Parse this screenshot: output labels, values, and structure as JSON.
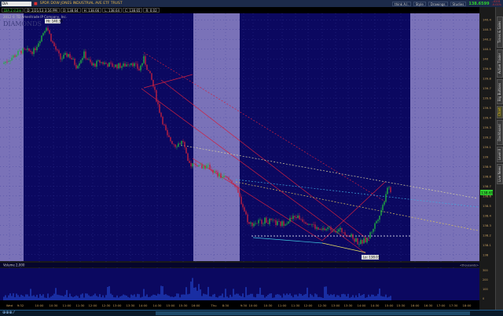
{
  "toolbar": {
    "symbol": "DIA",
    "description": "SPDR DOW JONES INDUSTRIAL AVE ETF TRUST",
    "buttons": [
      "think A.I.",
      "Style",
      "Drawings",
      "Studies"
    ],
    "last": "138.6599",
    "change": "-.0201",
    "change_pct": "-0.01%"
  },
  "infobar": {
    "aggregation": "DIA 2 d 2m",
    "date": "D: 2/21/13 3:16 PM",
    "open": "O: 138.64",
    "high": "H: 138.66",
    "low": "L: 138.64",
    "close": "C: 138.65",
    "range": "R: 0.02"
  },
  "side_tabs": [
    "Times & Sales",
    "Active Trader",
    "Big Buttons",
    "Chart",
    "Dashboard",
    "Level II",
    "Live News"
  ],
  "active_tab": "Chart",
  "chart_data": {
    "type": "candlestick",
    "copyright": "2012 © TD Ameritrade IP Company, Inc.",
    "watermark": "DIAMONDS",
    "hi_label": "Hi: 140.38",
    "lo_label": "Lo: 138.03",
    "current_price": "138.65",
    "current_value": 138.65,
    "ylim": [
      137.95,
      140.45
    ],
    "y_ticks": [
      "140.4",
      "140.3",
      "140.2",
      "140.1",
      "140",
      "139.9",
      "139.8",
      "139.7",
      "139.6",
      "139.5",
      "139.4",
      "139.3",
      "139.2",
      "139.1",
      "139",
      "138.9",
      "138.8",
      "138.7",
      "138.6",
      "138.5",
      "138.4",
      "138.3",
      "138.2",
      "138.1",
      "138"
    ],
    "x_ticks": [
      "Wed",
      "9:32",
      "10:00",
      "10:30",
      "11:00",
      "11:30",
      "12:00",
      "12:30",
      "13:00",
      "13:30",
      "14:00",
      "14:30",
      "15:00",
      "15:30",
      "16:00",
      "Thu",
      "8:30",
      "9:30",
      "10:00",
      "10:30",
      "11:00",
      "11:30",
      "12:00",
      "12:30",
      "13:00",
      "13:30",
      "14:00",
      "14:30",
      "15:00",
      "15:30",
      "16:00",
      "16:30",
      "17:00",
      "17:30",
      "18:00"
    ],
    "price_path": [
      [
        0,
        139.95
      ],
      [
        12,
        140.08
      ],
      [
        20,
        140.08
      ],
      [
        25,
        140.24
      ],
      [
        28,
        140.34
      ],
      [
        32,
        140.16
      ],
      [
        37,
        140.0
      ],
      [
        42,
        140.05
      ],
      [
        47,
        139.93
      ],
      [
        52,
        140.05
      ],
      [
        57,
        139.93
      ],
      [
        62,
        139.97
      ],
      [
        70,
        139.93
      ],
      [
        77,
        139.93
      ],
      [
        82,
        139.97
      ],
      [
        87,
        139.89
      ],
      [
        90,
        140.0
      ],
      [
        95,
        139.78
      ],
      [
        100,
        139.47
      ],
      [
        105,
        139.2
      ],
      [
        110,
        139.12
      ],
      [
        115,
        139.16
      ],
      [
        118,
        138.93
      ],
      [
        122,
        138.92
      ],
      [
        132,
        138.89
      ],
      [
        137,
        138.81
      ],
      [
        142,
        138.78
      ],
      [
        147,
        138.74
      ],
      [
        152,
        138.54
      ],
      [
        157,
        138.31
      ],
      [
        167,
        138.35
      ],
      [
        177,
        138.31
      ],
      [
        187,
        138.39
      ],
      [
        197,
        138.31
      ],
      [
        202,
        138.24
      ],
      [
        207,
        138.27
      ],
      [
        217,
        138.24
      ],
      [
        227,
        138.12
      ],
      [
        232,
        138.15
      ],
      [
        237,
        138.31
      ],
      [
        242,
        138.5
      ],
      [
        245,
        138.7
      ],
      [
        247,
        138.66
      ]
    ],
    "volume_label": "Volume",
    "volume_value": "2,000",
    "volume_units": "<thousands>",
    "volume_ticks": [
      "300",
      "200",
      "100",
      "0"
    ]
  }
}
